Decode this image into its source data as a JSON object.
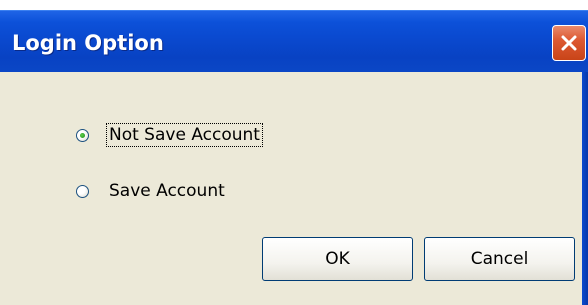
{
  "window": {
    "title": "Login Option",
    "close_icon": "close-icon"
  },
  "options": [
    {
      "label": "Not Save Account",
      "checked": true
    },
    {
      "label": "Save Account",
      "checked": false
    }
  ],
  "buttons": {
    "ok_label": "OK",
    "cancel_label": "Cancel"
  },
  "colors": {
    "titlebar": "#0a49cf",
    "panel": "#ece9d8",
    "close_button": "#dd5a34"
  }
}
